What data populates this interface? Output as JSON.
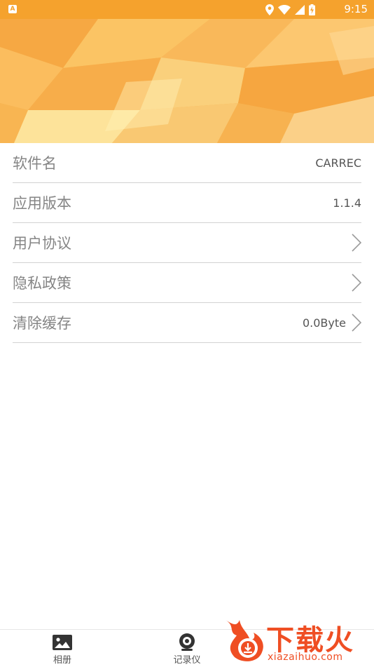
{
  "status_bar": {
    "time": "9:15",
    "icons": [
      "app-notification-icon",
      "location-icon",
      "wifi-icon",
      "cell-signal-icon",
      "battery-charging-icon"
    ]
  },
  "settings": {
    "items": [
      {
        "label": "软件名",
        "value": "CARREC",
        "has_chevron": false
      },
      {
        "label": "应用版本",
        "value": "1.1.4",
        "has_chevron": false
      },
      {
        "label": "用户协议",
        "value": "",
        "has_chevron": true
      },
      {
        "label": "隐私政策",
        "value": "",
        "has_chevron": true
      },
      {
        "label": "清除缓存",
        "value": "0.0Byte",
        "has_chevron": true
      }
    ]
  },
  "bottom_nav": {
    "items": [
      {
        "label": "相册",
        "icon": "photo-album-icon"
      },
      {
        "label": "记录仪",
        "icon": "dashcam-icon"
      }
    ]
  },
  "watermark": {
    "title": "下载火",
    "url": "xiazaihuo.com"
  },
  "colors": {
    "status_bar": "#f5a22d",
    "banner_base": "#f8b24c",
    "label_text": "#858585",
    "value_text": "#555555",
    "divider": "#d2d2d2",
    "watermark": "#ef4e23"
  }
}
